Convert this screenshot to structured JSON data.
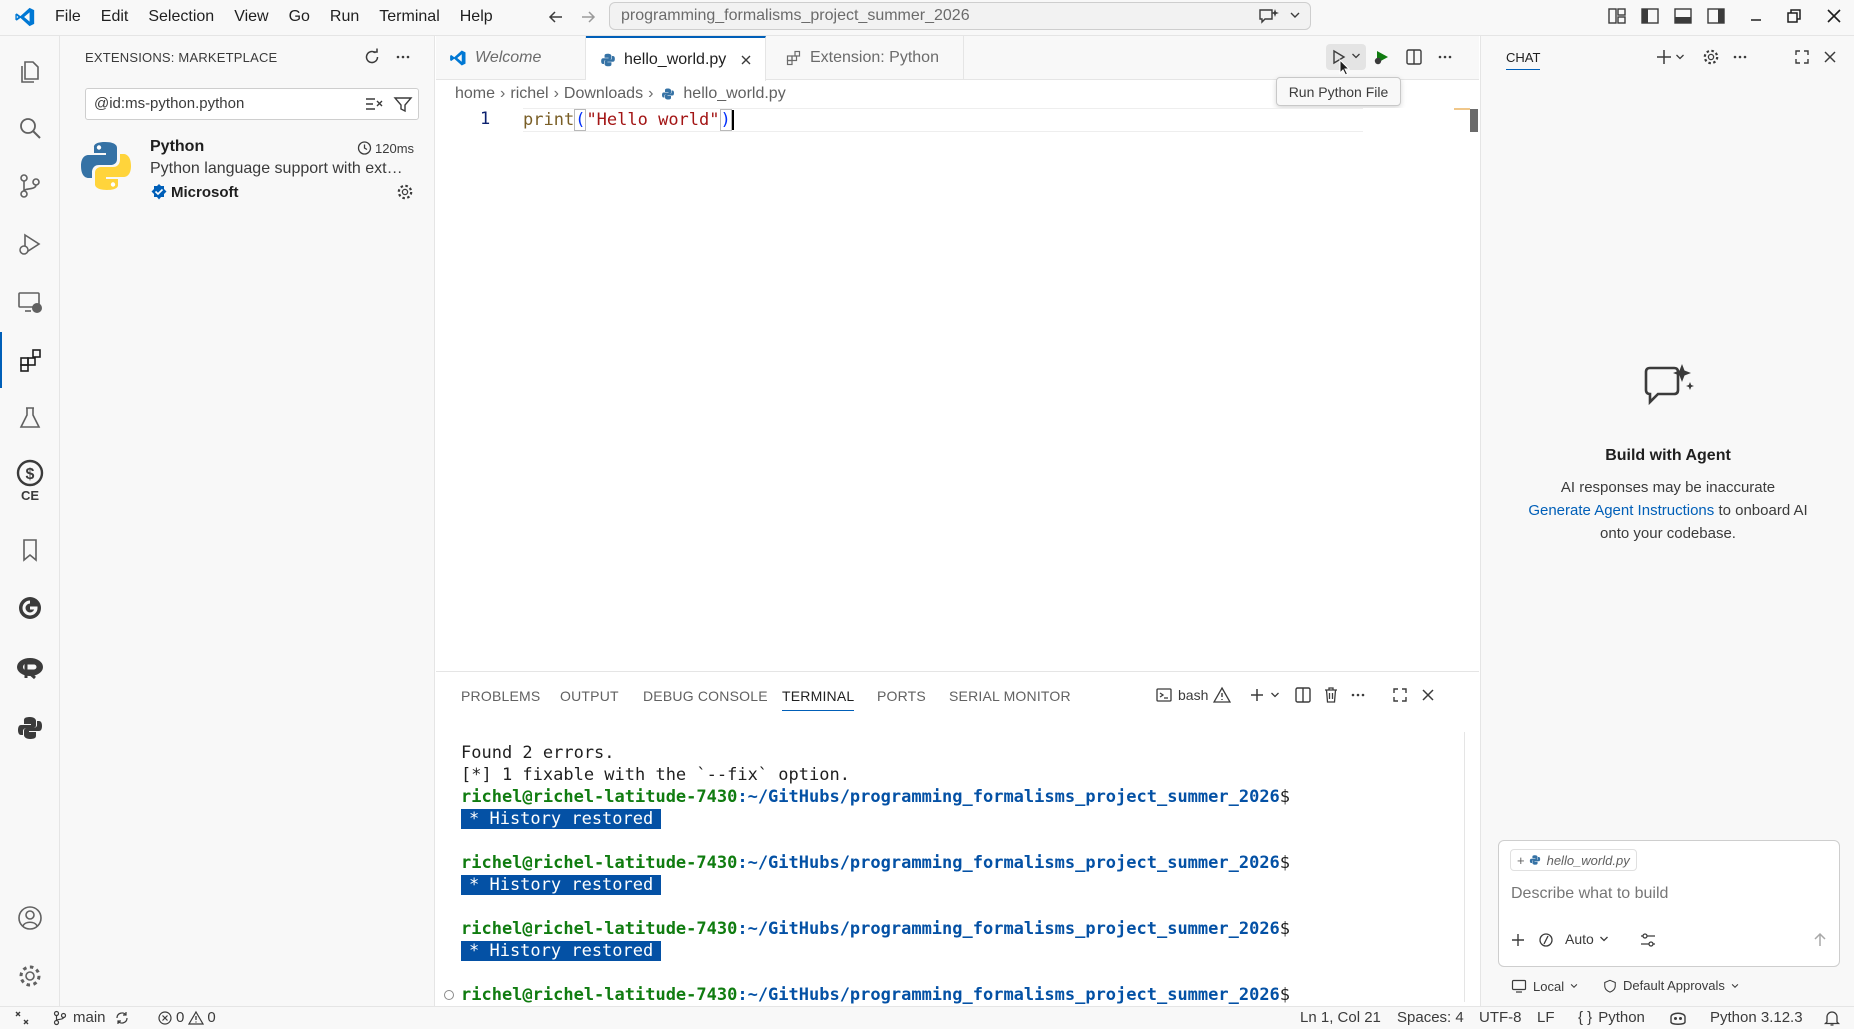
{
  "titlebar": {
    "menu": [
      "File",
      "Edit",
      "Selection",
      "View",
      "Go",
      "Run",
      "Terminal",
      "Help"
    ],
    "command_center": "programming_formalisms_project_summer_2026"
  },
  "sidebar": {
    "header": "EXTENSIONS: MARKETPLACE",
    "search_value": "@id:ms-python.python",
    "extension": {
      "name": "Python",
      "timing": "120ms",
      "description": "Python language support with ext…",
      "publisher": "Microsoft"
    }
  },
  "tabs": [
    {
      "label": "Welcome"
    },
    {
      "label": "hello_world.py"
    },
    {
      "label": "Extension: Python"
    }
  ],
  "breadcrumb": [
    "home",
    "richel",
    "Downloads",
    "hello_world.py"
  ],
  "editor": {
    "line_number": "1",
    "code_func": "print",
    "code_open": "(",
    "code_string": "\"Hello world\"",
    "code_close": ")"
  },
  "tooltip": "Run Python File",
  "panel": {
    "tabs": [
      "PROBLEMS",
      "OUTPUT",
      "DEBUG CONSOLE",
      "TERMINAL",
      "PORTS",
      "SERIAL MONITOR"
    ],
    "terminal_name": "bash",
    "lines": {
      "errors": "Found 2 errors.",
      "fixable": "[*] 1 fixable with the `--fix` option.",
      "user": "richel@richel-latitude-7430",
      "path": ":~/GitHubs/programming_formalisms_project_summer_2026",
      "dollar": "$",
      "history": "* History restored"
    }
  },
  "chat": {
    "title": "CHAT",
    "heading": "Build with Agent",
    "disclaimer": "AI responses may be inaccurate",
    "link": "Generate Agent Instructions",
    "after_link": "to onboard AI",
    "after_link2": "onto your codebase.",
    "context_file": "hello_world.py",
    "input_placeholder": "Describe what to build",
    "mode": "Auto",
    "location": "Local",
    "approvals": "Default Approvals"
  },
  "statusbar": {
    "branch": "main",
    "errors": "0",
    "warnings": "0",
    "position": "Ln 1, Col 21",
    "spaces": "Spaces: 4",
    "encoding": "UTF-8",
    "eol": "LF",
    "language": "Python",
    "interpreter": "Python 3.12.3"
  },
  "colors": {
    "accent": "#005fb8",
    "terminal_user": "#107c10",
    "terminal_path": "#0451a5",
    "string": "#a31515",
    "python_icon": "#3572a5"
  }
}
